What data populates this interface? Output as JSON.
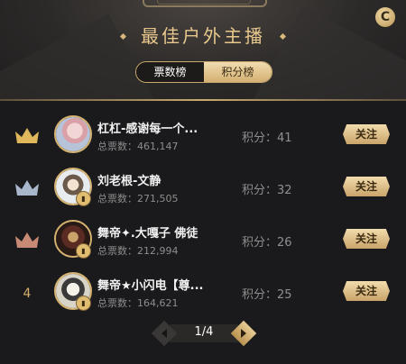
{
  "header": {
    "title": "最佳户外主播",
    "refresh_icon": "refresh-icon",
    "tabs": [
      {
        "label": "票数榜",
        "active": true
      },
      {
        "label": "积分榜",
        "active": false
      }
    ]
  },
  "colors": {
    "accent": "#d6b06c",
    "background": "#1a1a1c"
  },
  "list": [
    {
      "rank": "1",
      "rank_icon": "gold-crown-icon",
      "name": "杠杠-感谢每一个...",
      "votes": "总票数：461,147",
      "points": "积分：41",
      "follow": "关注"
    },
    {
      "rank": "2",
      "rank_icon": "silver-crown-icon",
      "name": "刘老根-文静",
      "votes": "总票数：271,505",
      "points": "积分：32",
      "follow": "关注"
    },
    {
      "rank": "3",
      "rank_icon": "bronze-crown-icon",
      "name": "舞帝✦.大嘎子 佛徒",
      "votes": "总票数：212,994",
      "points": "积分：26",
      "follow": "关注"
    },
    {
      "rank": "4",
      "rank_icon": "",
      "name": "舞帝★小闪电【尊...",
      "votes": "总票数：164,621",
      "points": "积分：25",
      "follow": "关注"
    }
  ],
  "pager": {
    "text": "1/4"
  }
}
